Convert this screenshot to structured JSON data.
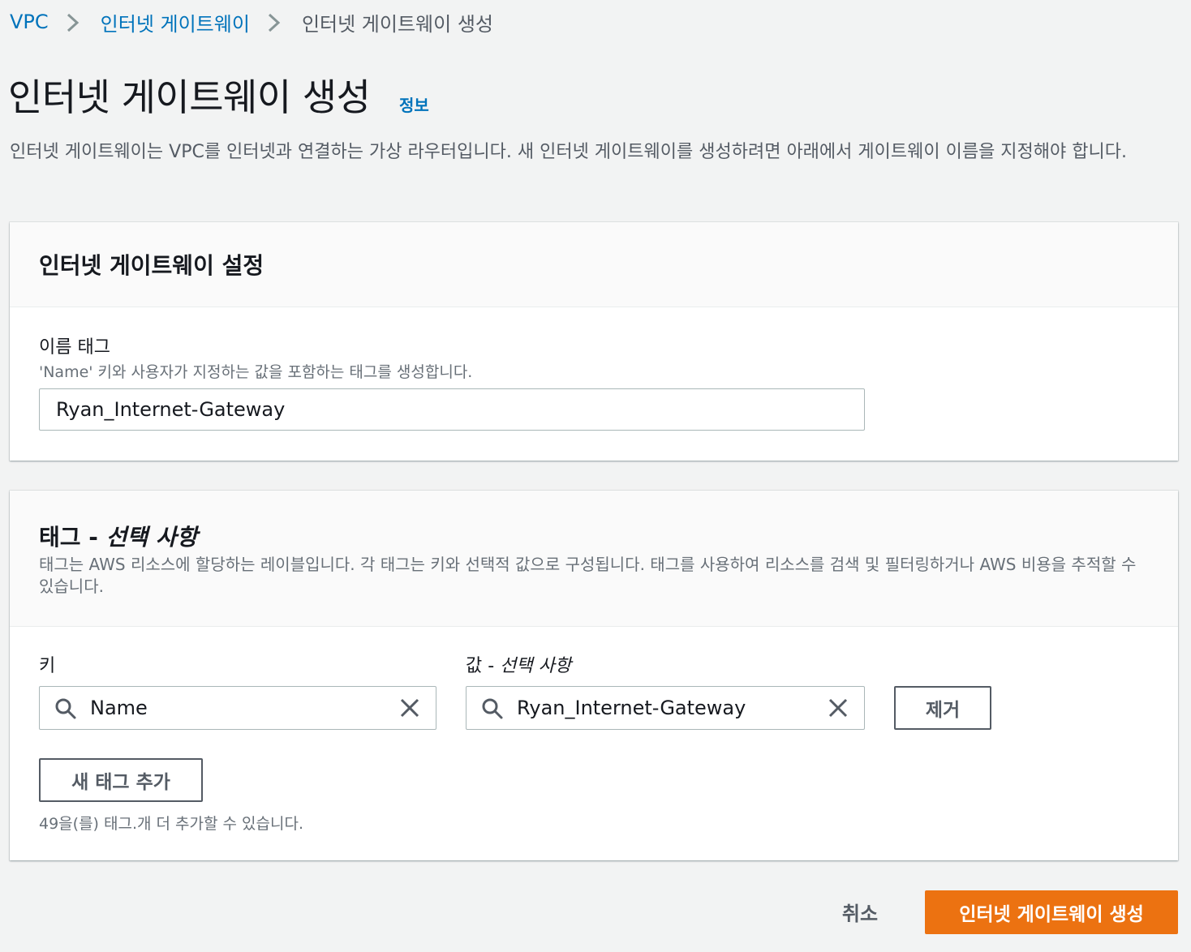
{
  "breadcrumb": {
    "items": [
      {
        "label": "VPC"
      },
      {
        "label": "인터넷 게이트웨이"
      },
      {
        "label": "인터넷 게이트웨이 생성"
      }
    ]
  },
  "header": {
    "title": "인터넷 게이트웨이 생성",
    "info_link": "정보",
    "description": "인터넷 게이트웨이는 VPC를 인터넷과 연결하는 가상 라우터입니다. 새 인터넷 게이트웨이를 생성하려면 아래에서 게이트웨이 이름을 지정해야 합니다."
  },
  "settings_panel": {
    "title": "인터넷 게이트웨이 설정",
    "name_tag": {
      "label": "이름 태그",
      "hint": "'Name' 키와 사용자가 지정하는 값을 포함하는 태그를 생성합니다.",
      "value": "Ryan_Internet-Gateway"
    }
  },
  "tags_panel": {
    "title": "태그 - ",
    "title_optional": "선택 사항",
    "description": "태그는 AWS 리소스에 할당하는 레이블입니다. 각 태그는 키와 선택적 값으로 구성됩니다. 태그를 사용하여 리소스를 검색 및 필터링하거나 AWS 비용을 추적할 수 있습니다.",
    "key_label": "키",
    "value_label": "값 - ",
    "value_label_optional": "선택 사항",
    "tags": [
      {
        "key": "Name",
        "value": "Ryan_Internet-Gateway",
        "remove_label": "제거"
      }
    ],
    "add_tag_label": "새 태그 추가",
    "remaining_hint": "49을(를) 태그.개 더 추가할 수 있습니다."
  },
  "footer": {
    "cancel_label": "취소",
    "submit_label": "인터넷 게이트웨이 생성"
  },
  "colors": {
    "link": "#0073bb",
    "primary_button": "#ec7211",
    "background": "#f2f3f3"
  },
  "icons": [
    "chevron-right-icon",
    "search-icon",
    "clear-icon"
  ]
}
